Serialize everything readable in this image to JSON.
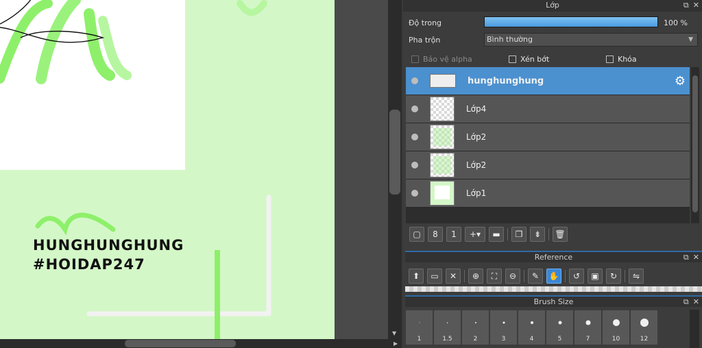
{
  "canvas": {
    "art_line1": "HUNGHUNGHUNG",
    "art_line2": "#HOIDAP247"
  },
  "layer_panel": {
    "title": "Lớp",
    "opacity_label": "Độ trong",
    "opacity_value": "100 %",
    "opacity_fraction": 1.0,
    "blend_label": "Pha trộn",
    "blend_value": "Bình thường",
    "protect_alpha": "Bảo vệ alpha",
    "clipping": "Xén bớt",
    "lock": "Khóa",
    "layers": [
      {
        "name": "hunghunghung",
        "selected": true
      },
      {
        "name": "Lớp4",
        "selected": false
      },
      {
        "name": "Lớp2",
        "selected": false
      },
      {
        "name": "Lớp2",
        "selected": false
      },
      {
        "name": "Lớp1",
        "selected": false
      }
    ]
  },
  "reference_panel": {
    "title": "Reference"
  },
  "brush_panel": {
    "title": "Brush Size",
    "sizes": [
      "1",
      "1.5",
      "2",
      "3",
      "4",
      "5",
      "7",
      "10",
      "12"
    ]
  },
  "colors": {
    "accent": "#4b90cf",
    "canvas_green": "#d4f7c8"
  }
}
